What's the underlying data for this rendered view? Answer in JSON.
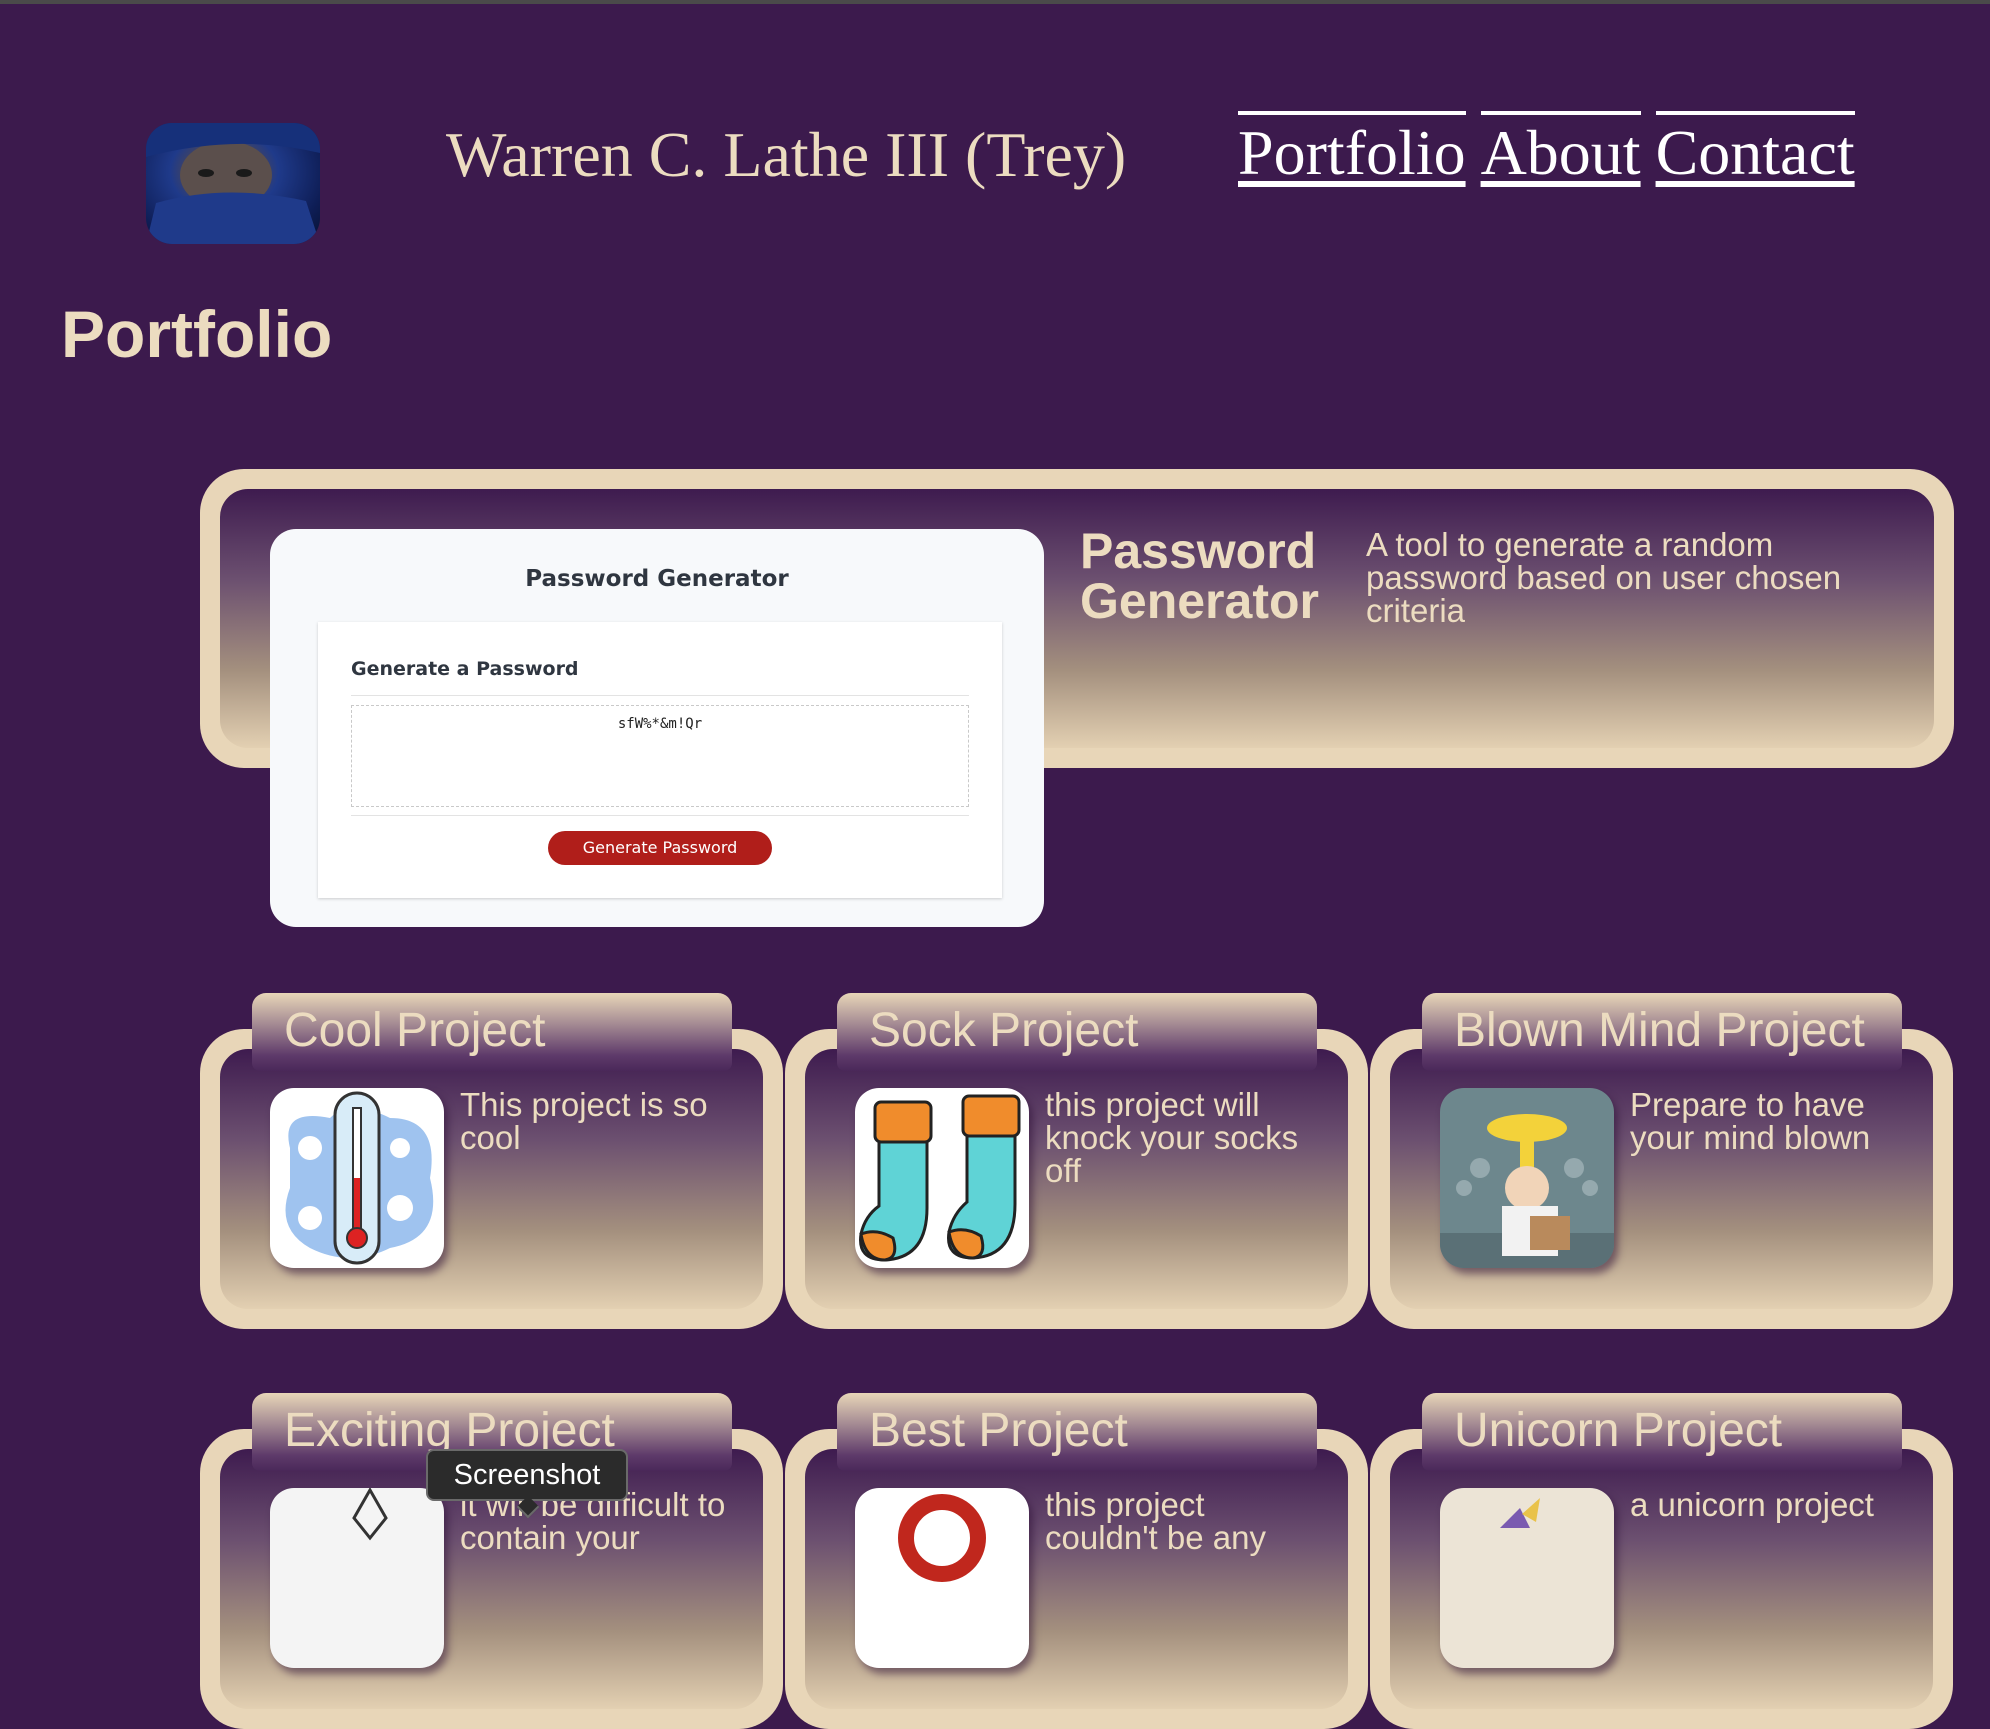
{
  "header": {
    "site_title": "Warren C. Lathe III (Trey)",
    "nav": [
      "Portfolio",
      "About",
      "Contact"
    ]
  },
  "page_heading": "Portfolio",
  "featured": {
    "title": "Password Generator",
    "description": "A tool to generate a random password based on user chosen criteria",
    "preview": {
      "title": "Password Generator",
      "subheading": "Generate a Password",
      "password": "sfW%*&m!Qr",
      "button": "Generate Password"
    }
  },
  "projects": [
    {
      "title": "Cool Project",
      "description": "This project is so cool",
      "icon": "thermometer-icon"
    },
    {
      "title": "Sock Project",
      "description": "this project will knock your socks off",
      "icon": "socks-icon"
    },
    {
      "title": "Blown Mind Project",
      "description": "Prepare to have your mind blown",
      "icon": "mind-blown-icon"
    },
    {
      "title": "Exciting Project",
      "description": "it will be difficult to contain your",
      "icon": "exciting-icon"
    },
    {
      "title": "Best Project",
      "description": "this project couldn't be any",
      "icon": "ribbon-icon"
    },
    {
      "title": "Unicorn Project",
      "description": "a unicorn project",
      "icon": "unicorn-icon"
    }
  ],
  "tooltip": "Screenshot",
  "colors": {
    "background": "#3c1a4d",
    "card": "#e8d6b8",
    "text": "#ecdcc0",
    "button": "#b01e1a"
  }
}
